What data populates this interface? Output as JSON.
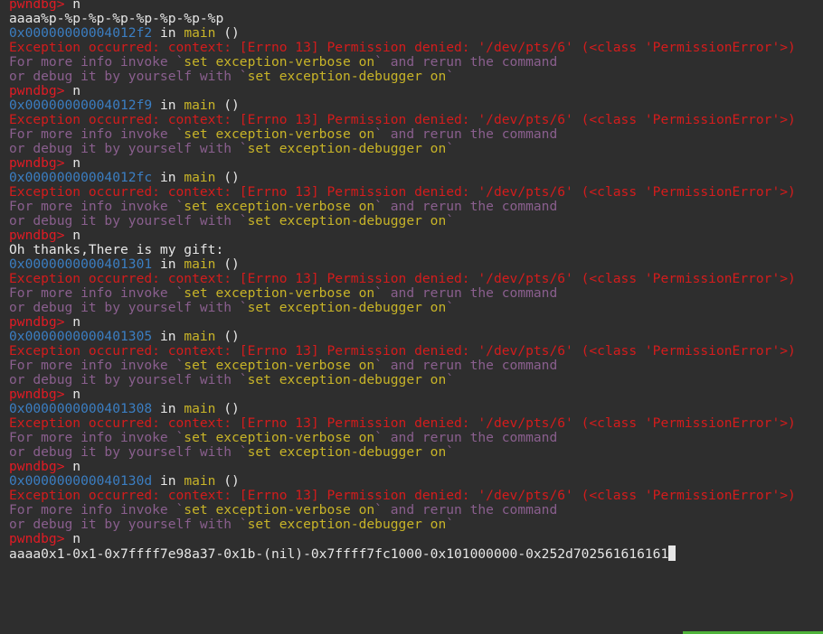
{
  "colors": {
    "background": "#2e2e2e",
    "prompt": "#e01b24",
    "address": "#3b7ec2",
    "function": "#c8b428",
    "error": "#d41c1c",
    "hint": "#8a5f8e",
    "text": "#e6e6e6",
    "indicator": "#4fb33a"
  },
  "terminal": {
    "lines": [
      {
        "kind": "prompt",
        "prompt": "pwndbg>",
        "cmd": " n"
      },
      {
        "kind": "output",
        "text": "aaaa%p-%p-%p-%p-%p-%p-%p-%p"
      },
      {
        "kind": "frame",
        "addr": "0x00000000004012f2",
        "in": " in ",
        "func": "main",
        "args": " ()"
      },
      {
        "kind": "error",
        "text": "Exception occurred: context: [Errno 13] Permission denied: '/dev/pts/6' (<class 'PermissionError'>)"
      },
      {
        "kind": "hint",
        "pre": "For more info invoke `",
        "cmd": "set exception-verbose on",
        "post": "` and rerun the command"
      },
      {
        "kind": "hint",
        "pre": "or debug it by yourself with `",
        "cmd": "set exception-debugger on",
        "post": "`"
      },
      {
        "kind": "prompt",
        "prompt": "pwndbg>",
        "cmd": " n"
      },
      {
        "kind": "frame",
        "addr": "0x00000000004012f9",
        "in": " in ",
        "func": "main",
        "args": " ()"
      },
      {
        "kind": "error",
        "text": "Exception occurred: context: [Errno 13] Permission denied: '/dev/pts/6' (<class 'PermissionError'>)"
      },
      {
        "kind": "hint",
        "pre": "For more info invoke `",
        "cmd": "set exception-verbose on",
        "post": "` and rerun the command"
      },
      {
        "kind": "hint",
        "pre": "or debug it by yourself with `",
        "cmd": "set exception-debugger on",
        "post": "`"
      },
      {
        "kind": "prompt",
        "prompt": "pwndbg>",
        "cmd": " n"
      },
      {
        "kind": "frame",
        "addr": "0x00000000004012fc",
        "in": " in ",
        "func": "main",
        "args": " ()"
      },
      {
        "kind": "error",
        "text": "Exception occurred: context: [Errno 13] Permission denied: '/dev/pts/6' (<class 'PermissionError'>)"
      },
      {
        "kind": "hint",
        "pre": "For more info invoke `",
        "cmd": "set exception-verbose on",
        "post": "` and rerun the command"
      },
      {
        "kind": "hint",
        "pre": "or debug it by yourself with `",
        "cmd": "set exception-debugger on",
        "post": "`"
      },
      {
        "kind": "prompt",
        "prompt": "pwndbg>",
        "cmd": " n"
      },
      {
        "kind": "output",
        "text": "Oh thanks,There is my gift:"
      },
      {
        "kind": "frame",
        "addr": "0x0000000000401301",
        "in": " in ",
        "func": "main",
        "args": " ()"
      },
      {
        "kind": "error",
        "text": "Exception occurred: context: [Errno 13] Permission denied: '/dev/pts/6' (<class 'PermissionError'>)"
      },
      {
        "kind": "hint",
        "pre": "For more info invoke `",
        "cmd": "set exception-verbose on",
        "post": "` and rerun the command"
      },
      {
        "kind": "hint",
        "pre": "or debug it by yourself with `",
        "cmd": "set exception-debugger on",
        "post": "`"
      },
      {
        "kind": "prompt",
        "prompt": "pwndbg>",
        "cmd": " n"
      },
      {
        "kind": "frame",
        "addr": "0x0000000000401305",
        "in": " in ",
        "func": "main",
        "args": " ()"
      },
      {
        "kind": "error",
        "text": "Exception occurred: context: [Errno 13] Permission denied: '/dev/pts/6' (<class 'PermissionError'>)"
      },
      {
        "kind": "hint",
        "pre": "For more info invoke `",
        "cmd": "set exception-verbose on",
        "post": "` and rerun the command"
      },
      {
        "kind": "hint",
        "pre": "or debug it by yourself with `",
        "cmd": "set exception-debugger on",
        "post": "`"
      },
      {
        "kind": "prompt",
        "prompt": "pwndbg>",
        "cmd": " n"
      },
      {
        "kind": "frame",
        "addr": "0x0000000000401308",
        "in": " in ",
        "func": "main",
        "args": " ()"
      },
      {
        "kind": "error",
        "text": "Exception occurred: context: [Errno 13] Permission denied: '/dev/pts/6' (<class 'PermissionError'>)"
      },
      {
        "kind": "hint",
        "pre": "For more info invoke `",
        "cmd": "set exception-verbose on",
        "post": "` and rerun the command"
      },
      {
        "kind": "hint",
        "pre": "or debug it by yourself with `",
        "cmd": "set exception-debugger on",
        "post": "`"
      },
      {
        "kind": "prompt",
        "prompt": "pwndbg>",
        "cmd": " n"
      },
      {
        "kind": "frame",
        "addr": "0x000000000040130d",
        "in": " in ",
        "func": "main",
        "args": " ()"
      },
      {
        "kind": "error",
        "text": "Exception occurred: context: [Errno 13] Permission denied: '/dev/pts/6' (<class 'PermissionError'>)"
      },
      {
        "kind": "hint",
        "pre": "For more info invoke `",
        "cmd": "set exception-verbose on",
        "post": "` and rerun the command"
      },
      {
        "kind": "hint",
        "pre": "or debug it by yourself with `",
        "cmd": "set exception-debugger on",
        "post": "`"
      },
      {
        "kind": "prompt",
        "prompt": "pwndbg>",
        "cmd": " n"
      },
      {
        "kind": "output_cursor",
        "text": "aaaa0x1-0x1-0x7ffff7e98a37-0x1b-(nil)-0x7ffff7fc1000-0x101000000-0x252d702561616161"
      }
    ]
  }
}
